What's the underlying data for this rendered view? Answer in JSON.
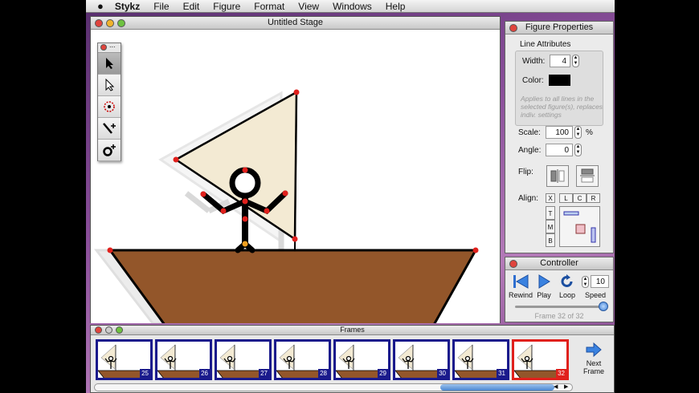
{
  "menubar": {
    "apple": "",
    "app": "Stykz",
    "items": [
      "File",
      "Edit",
      "Figure",
      "Format",
      "View",
      "Windows",
      "Help"
    ]
  },
  "stage": {
    "title": "Untitled Stage",
    "toolbox_title": "..."
  },
  "figure_properties": {
    "title": "Figure Properties",
    "line_attributes": "Line Attributes",
    "width_label": "Width:",
    "width_value": "4",
    "color_label": "Color:",
    "color_value": "#000000",
    "note": "Applies to all lines in the selected figure(s), replaces indiv. settings",
    "scale_label": "Scale:",
    "scale_value": "100",
    "scale_unit": "%",
    "angle_label": "Angle:",
    "angle_value": "0",
    "flip_label": "Flip:",
    "align_label": "Align:",
    "align_x": "X",
    "align_h": [
      "L",
      "C",
      "R"
    ],
    "align_v": [
      "T",
      "M",
      "B"
    ]
  },
  "controller": {
    "title": "Controller",
    "rewind": "Rewind",
    "play": "Play",
    "loop": "Loop",
    "speed_label": "Speed",
    "speed_value": "10",
    "frame_status": "Frame 32 of 32",
    "progress": 1.0
  },
  "frames": {
    "title": "Frames",
    "items": [
      {
        "n": "25"
      },
      {
        "n": "26"
      },
      {
        "n": "27"
      },
      {
        "n": "28"
      },
      {
        "n": "29"
      },
      {
        "n": "30"
      },
      {
        "n": "31"
      },
      {
        "n": "32"
      }
    ],
    "current": "32",
    "next_label_1": "Next",
    "next_label_2": "Frame"
  },
  "colors": {
    "sail": "#f3ead3",
    "boat": "#93562a",
    "handle": "#e0201c",
    "selected_frame": "#e0201c",
    "frame_border": "#1a1a8c"
  }
}
